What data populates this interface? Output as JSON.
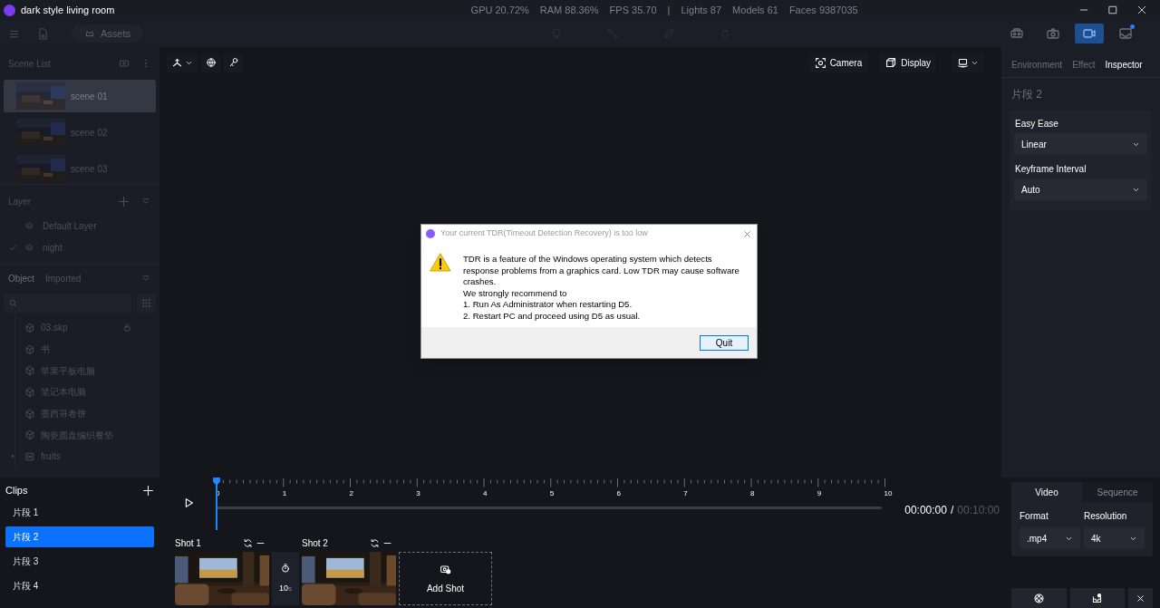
{
  "title_bar": {
    "title": "dark style living room",
    "stats": [
      "GPU 20.72%",
      "RAM 88.36%",
      "FPS 35.70",
      "|",
      "Lights 87",
      "Models 61",
      "Faces 9387035"
    ]
  },
  "toolbar": {
    "assets_label": "Assets",
    "modes": [
      {
        "kind": "vr",
        "selected": false
      },
      {
        "kind": "camera",
        "selected": false
      },
      {
        "kind": "video",
        "selected": true
      },
      {
        "kind": "inbox",
        "selected": false
      }
    ]
  },
  "scene_list": {
    "title": "Scene List",
    "scenes": [
      {
        "name": "scene 01",
        "selected": true
      },
      {
        "name": "scene 02",
        "selected": false
      },
      {
        "name": "scene 03",
        "selected": false
      }
    ]
  },
  "layer": {
    "title": "Layer",
    "items": [
      {
        "name": "Default Layer",
        "checked": false
      },
      {
        "name": "night",
        "checked": true
      }
    ]
  },
  "object": {
    "tabs": [
      {
        "label": "Object",
        "selected": true
      },
      {
        "label": "Imported",
        "selected": false
      }
    ],
    "items": [
      {
        "name": "03.skp",
        "kind": "model",
        "locked": true
      },
      {
        "name": "书",
        "kind": "model",
        "locked": false
      },
      {
        "name": "苹果平板电脑",
        "kind": "model",
        "locked": false
      },
      {
        "name": "笔记本电脑",
        "kind": "model",
        "locked": false
      },
      {
        "name": "墨西哥卷饼",
        "kind": "model",
        "locked": false
      },
      {
        "name": "陶瓷圆盘编织餐垫",
        "kind": "model",
        "locked": false
      },
      {
        "name": "fruits",
        "kind": "group",
        "locked": false
      }
    ]
  },
  "viewport": {
    "camera_label": "Camera",
    "display_label": "Display"
  },
  "inspector": {
    "tabs": [
      {
        "label": "Environment",
        "selected": false
      },
      {
        "label": "Effect",
        "selected": false
      },
      {
        "label": "Inspector",
        "selected": true
      }
    ],
    "clip_title": "片段 2",
    "fields": [
      {
        "label": "Easy Ease",
        "value": "Linear"
      },
      {
        "label": "Keyframe Interval",
        "value": "Auto"
      }
    ]
  },
  "dialog": {
    "title": "Your current TDR(Timeout Detection Recovery) is too low",
    "lines": [
      "TDR is a feature of the Windows operating system which detects response problems from a graphics card. Low TDR may cause software crashes.",
      "We strongly recommend to",
      "1. Run As Administrator when restarting D5.",
      "2. Restart PC and proceed using D5 as usual."
    ],
    "button": "Quit"
  },
  "clips": {
    "title": "Clips",
    "items": [
      {
        "name": "片段 1",
        "selected": false
      },
      {
        "name": "片段 2",
        "selected": true
      },
      {
        "name": "片段 3",
        "selected": false
      },
      {
        "name": "片段 4",
        "selected": false
      }
    ]
  },
  "timeline": {
    "ticks": [
      "0",
      "1",
      "2",
      "3",
      "4",
      "5",
      "6",
      "7",
      "8",
      "9",
      "10"
    ],
    "time_current": "00:00:00",
    "time_separator": "/",
    "time_total": "00:10:00",
    "shots": [
      {
        "label": "Shot 1"
      },
      {
        "label": "Shot 2"
      }
    ],
    "duration": "10",
    "duration_unit": "s",
    "add_shot": "Add Shot"
  },
  "export": {
    "tabs": [
      {
        "label": "Video",
        "selected": true
      },
      {
        "label": "Sequence",
        "selected": false
      }
    ],
    "fields": [
      {
        "label": "Format",
        "value": ".mp4"
      },
      {
        "label": "Resolution",
        "value": "4k"
      }
    ]
  }
}
